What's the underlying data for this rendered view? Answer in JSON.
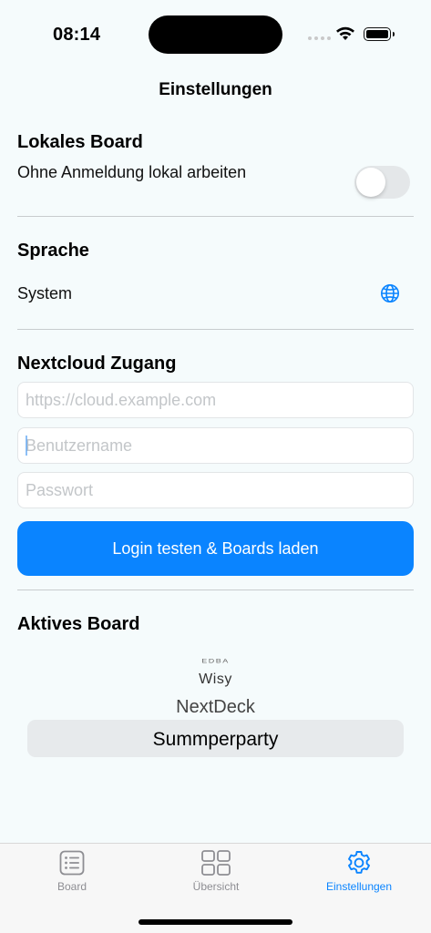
{
  "status_bar": {
    "time": "08:14"
  },
  "nav": {
    "title": "Einstellungen"
  },
  "local_board": {
    "title": "Lokales Board",
    "toggle_label": "Ohne Anmeldung lokal arbeiten",
    "toggle_on": false
  },
  "language": {
    "title": "Sprache",
    "value": "System",
    "icon": "globe-icon"
  },
  "nextcloud": {
    "title": "Nextcloud Zugang",
    "url_placeholder": "https://cloud.example.com",
    "username_placeholder": "Benutzername",
    "password_placeholder": "Passwort",
    "login_button": "Login testen & Boards laden"
  },
  "active_board": {
    "title": "Aktives Board",
    "options": [
      "EDBA",
      "Wisy",
      "NextDeck",
      "Summperparty"
    ],
    "selected": "Summperparty"
  },
  "tab_bar": {
    "tabs": [
      {
        "label": "Board",
        "icon": "list-icon",
        "active": false
      },
      {
        "label": "Übersicht",
        "icon": "grid-icon",
        "active": false
      },
      {
        "label": "Einstellungen",
        "icon": "gear-icon",
        "active": true
      }
    ]
  },
  "colors": {
    "accent": "#0a84ff",
    "background": "#f5fbfc",
    "inactive_tab": "#8e8e93"
  }
}
